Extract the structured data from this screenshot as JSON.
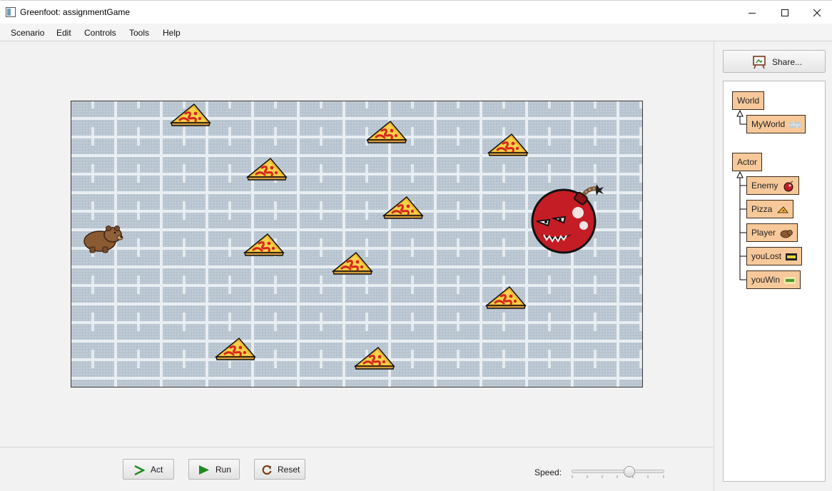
{
  "window": {
    "title": "Greenfoot: assignmentGame"
  },
  "menu": [
    "Scenario",
    "Edit",
    "Controls",
    "Tools",
    "Help"
  ],
  "share": {
    "label": "Share..."
  },
  "classes": {
    "world_root": "World",
    "world_sub": "MyWorld",
    "actor_root": "Actor",
    "actor_subs": [
      "Enemy",
      "Pizza",
      "Player",
      "youLost",
      "youWin"
    ]
  },
  "controls": {
    "act": "Act",
    "run": "Run",
    "reset": "Reset",
    "speed_label": "Speed:",
    "speed_value": 0.62
  },
  "colors": {
    "class_box": "#f7c99a",
    "run_green": "#1f8a1f",
    "reset_brown": "#7a3b10"
  }
}
